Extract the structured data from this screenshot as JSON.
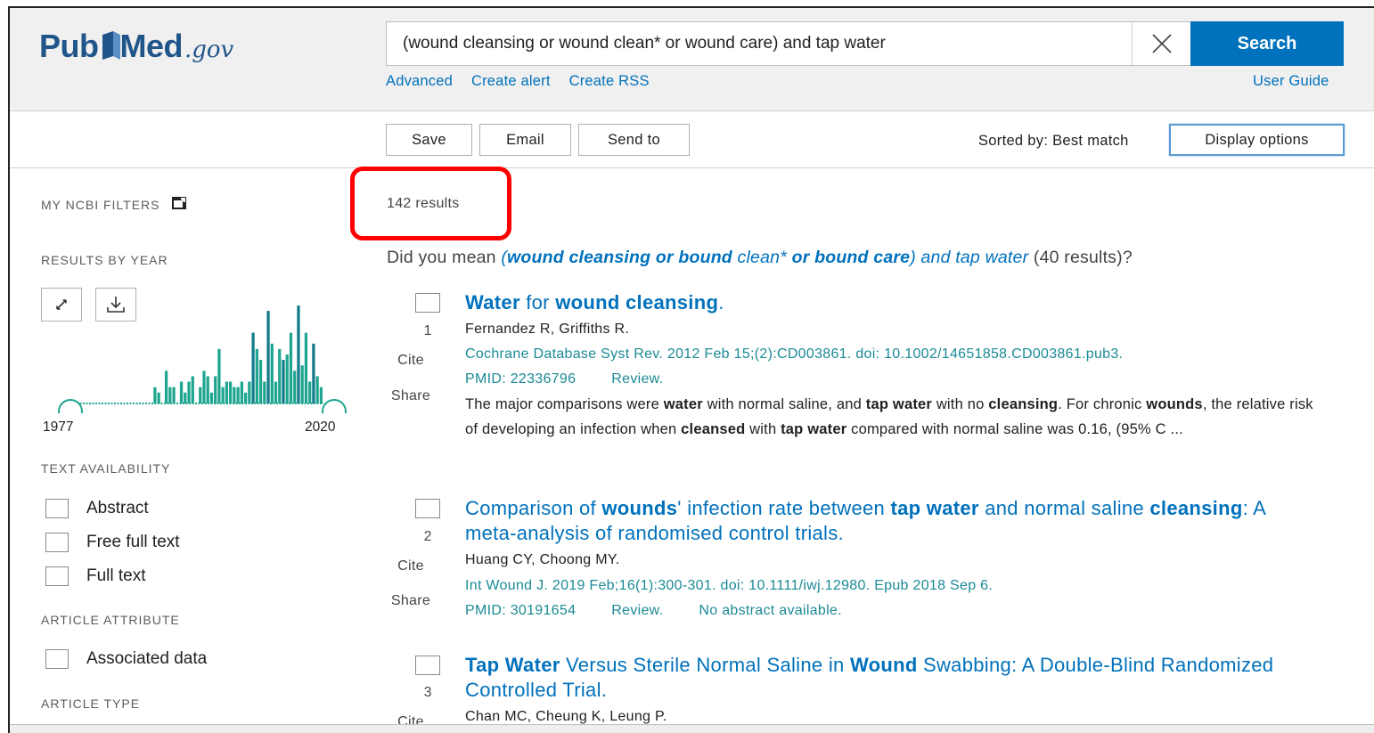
{
  "header": {
    "logo_pub": "Pub",
    "logo_med": "Med",
    "logo_gov": ".gov",
    "search_value": "(wound cleansing or wound clean* or wound care) and tap water",
    "search_button": "Search",
    "links": [
      "Advanced",
      "Create alert",
      "Create RSS"
    ],
    "user_guide": "User Guide"
  },
  "toolbar": {
    "save": "Save",
    "email": "Email",
    "send_to": "Send to",
    "sorted_by": "Sorted by: Best match",
    "display_options": "Display options"
  },
  "sidebar": {
    "my_ncbi_filters": "MY NCBI FILTERS",
    "results_by_year": "RESULTS BY YEAR",
    "year_start": "1977",
    "year_end": "2020",
    "year_chart_values": [
      1,
      1,
      1,
      1,
      1,
      1,
      1,
      1,
      1,
      1,
      1,
      1,
      1,
      1,
      1,
      1,
      1,
      1,
      1,
      1,
      1,
      1,
      3,
      2,
      1,
      6,
      3,
      3,
      1,
      4,
      2,
      4,
      5,
      1,
      3,
      6,
      5,
      2,
      5,
      10,
      3,
      4,
      4,
      3,
      3,
      4,
      2,
      4,
      13,
      10,
      8,
      4,
      17,
      11,
      4,
      10,
      8,
      9,
      13,
      6,
      18,
      7,
      13,
      4,
      11,
      5,
      3
    ],
    "text_availability": "TEXT AVAILABILITY",
    "text_filters": [
      "Abstract",
      "Free full text",
      "Full text"
    ],
    "article_attribute": "ARTICLE ATTRIBUTE",
    "attribute_filters": [
      "Associated data"
    ],
    "article_type": "ARTICLE TYPE"
  },
  "results": {
    "count": "142 results",
    "did_you_mean": {
      "prefix": "Did you mean ",
      "p1": "(",
      "b1": "wound cleansing or bound",
      "p2": " clean* ",
      "b2": "or bound care",
      "p3": ") and tap water",
      "suffix": " (40 results)?"
    },
    "items": [
      {
        "num": "1",
        "cite": "Cite",
        "share": "Share",
        "title_parts": [
          {
            "t": "Water",
            "b": true
          },
          {
            "t": " for ",
            "b": false
          },
          {
            "t": "wound cleansing",
            "b": true
          },
          {
            "t": ".",
            "b": false
          }
        ],
        "authors": "Fernandez R, Griffiths R.",
        "citation": "Cochrane Database Syst Rev. 2012 Feb 15;(2):CD003861. doi: 10.1002/14651858.CD003861.pub3.",
        "pmid": "PMID: 22336796",
        "tags": [
          "Review."
        ],
        "snippet_parts": [
          {
            "t": "The major comparisons were ",
            "b": false
          },
          {
            "t": "water",
            "b": true
          },
          {
            "t": " with normal saline, and ",
            "b": false
          },
          {
            "t": "tap water",
            "b": true
          },
          {
            "t": " with no ",
            "b": false
          },
          {
            "t": "cleansing",
            "b": true
          },
          {
            "t": ". For chronic ",
            "b": false
          },
          {
            "t": "wounds",
            "b": true
          },
          {
            "t": ", the relative risk of developing an infection when ",
            "b": false
          },
          {
            "t": "cleansed",
            "b": true
          },
          {
            "t": " with ",
            "b": false
          },
          {
            "t": "tap water",
            "b": true
          },
          {
            "t": " compared with normal saline was 0.16, (95% C ...",
            "b": false
          }
        ]
      },
      {
        "num": "2",
        "cite": "Cite",
        "share": "Share",
        "title_parts": [
          {
            "t": "Comparison of ",
            "b": false
          },
          {
            "t": "wounds",
            "b": true
          },
          {
            "t": "' infection rate between ",
            "b": false
          },
          {
            "t": "tap water",
            "b": true
          },
          {
            "t": " and normal saline ",
            "b": false
          },
          {
            "t": "cleansing",
            "b": true
          },
          {
            "t": ": A meta-analysis of randomised control trials.",
            "b": false
          }
        ],
        "authors": "Huang CY, Choong MY.",
        "citation": "Int Wound J. 2019 Feb;16(1):300-301. doi: 10.1111/iwj.12980. Epub 2018 Sep 6.",
        "pmid": "PMID: 30191654",
        "tags": [
          "Review.",
          "No abstract available."
        ]
      },
      {
        "num": "3",
        "cite": "Cite",
        "title_parts": [
          {
            "t": "Tap Water",
            "b": true
          },
          {
            "t": " Versus Sterile Normal Saline in ",
            "b": false
          },
          {
            "t": "Wound",
            "b": true
          },
          {
            "t": " Swabbing: A Double-Blind Randomized Controlled Trial.",
            "b": false
          }
        ],
        "authors": "Chan MC, Cheung K, Leung P."
      }
    ]
  },
  "colors": {
    "brand": "#20558a",
    "link": "#0071bc",
    "citation": "#1b8a96",
    "chart_bar": "#1ea58f",
    "highlight": "#ff0000"
  }
}
